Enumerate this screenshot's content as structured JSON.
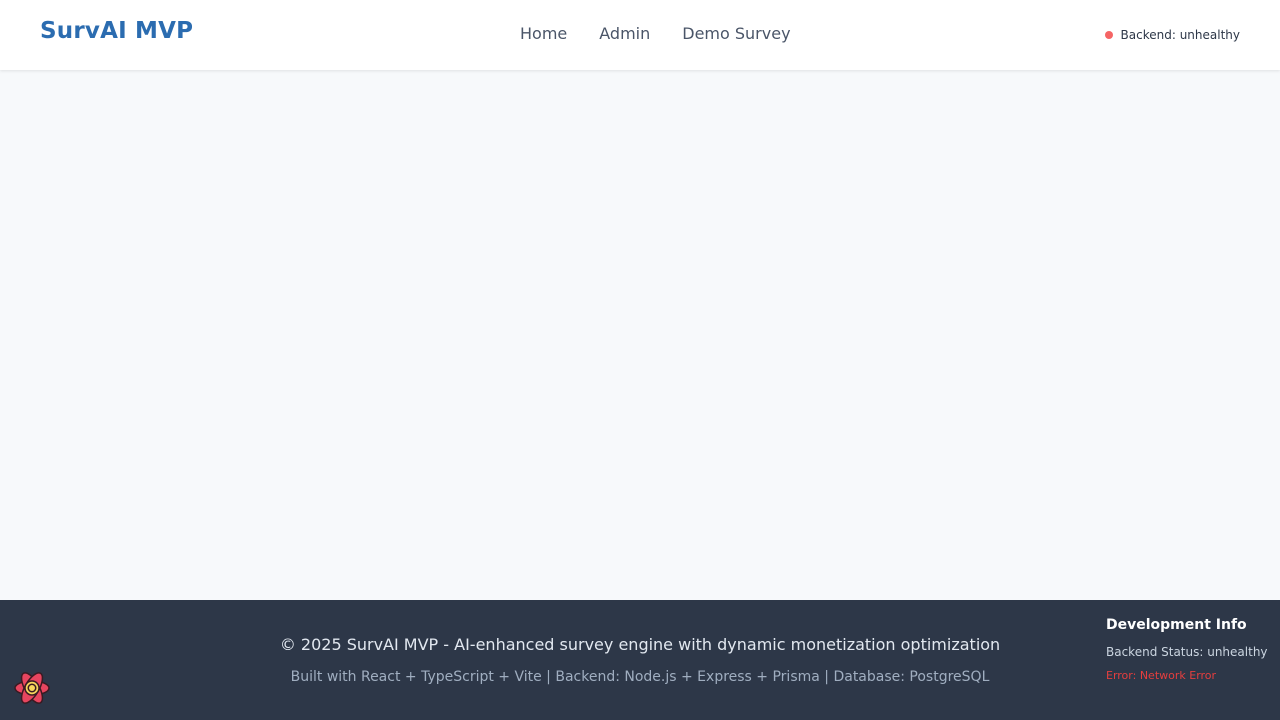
{
  "header": {
    "brand": "SurvAI MVP",
    "nav": [
      "Home",
      "Admin",
      "Demo Survey"
    ],
    "status": {
      "text": "Backend: unhealthy",
      "color": "#f56565"
    }
  },
  "footer": {
    "copyright": "© 2025 SurvAI MVP - AI-enhanced survey engine with dynamic monetization optimization",
    "built_with": "Built with React + TypeScript + Vite | Backend: Node.js + Express + Prisma | Database: PostgreSQL"
  },
  "dev_info": {
    "title": "Development Info",
    "backend_status": "Backend Status: unhealthy",
    "error": "Error: Network Error"
  },
  "icons": {
    "devtools": "react-query-devtools-icon"
  },
  "colors": {
    "brand": "#2b6cb0",
    "footer_bg": "#2d3748",
    "error": "#e53e3e"
  }
}
